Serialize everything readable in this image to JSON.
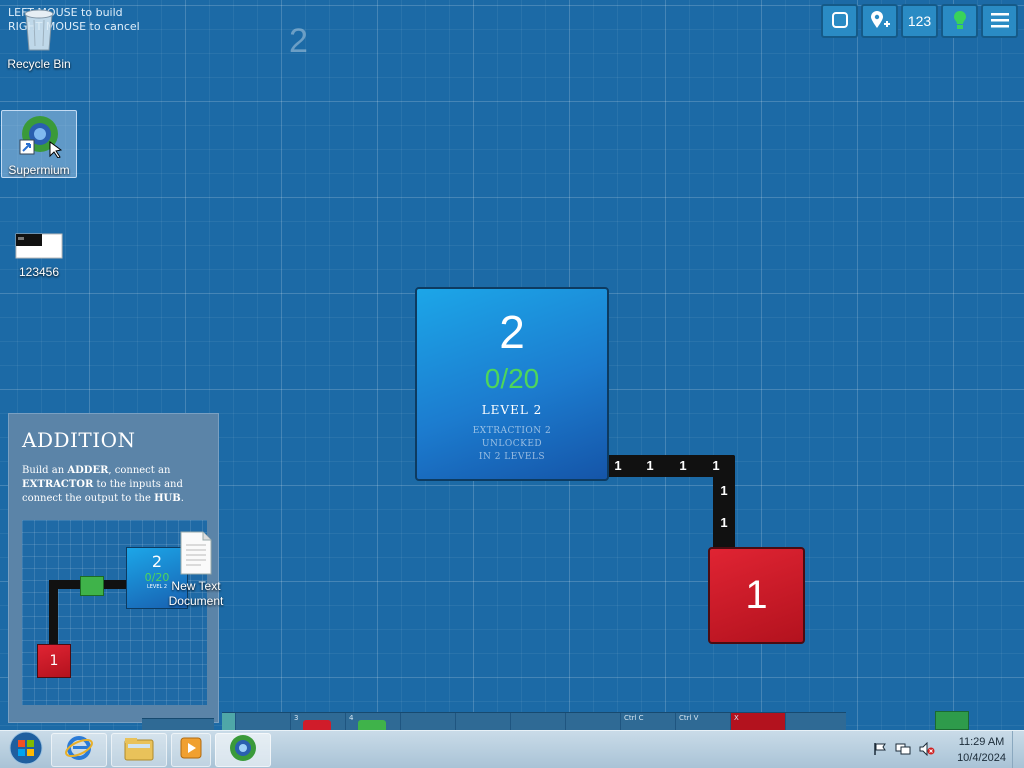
{
  "hint": {
    "line1": "LEFT MOUSE to build",
    "line2": "RIGHT MOUSE to cancel"
  },
  "level_watermark": "2",
  "desktop": {
    "icons": [
      {
        "label": "Recycle Bin"
      },
      {
        "label": "Supermium"
      },
      {
        "label": "123456"
      }
    ],
    "file_icon": {
      "line1": "New Text",
      "line2": "Document"
    }
  },
  "toolbar": {
    "counter_label": "123"
  },
  "hub": {
    "number": "2",
    "progress": "0/20",
    "level": "LEVEL 2",
    "unlock_line1": "EXTRACTION 2",
    "unlock_line2": "UNLOCKED",
    "unlock_line3": "IN 2 LEVELS"
  },
  "extractor": {
    "number": "1"
  },
  "belt_tokens": [
    "1",
    "1",
    "1",
    "1",
    "1",
    "1"
  ],
  "tutorial": {
    "title": "ADDITION",
    "desc_1": "Build an ",
    "desc_adder": "ADDER",
    "desc_2": ", connect an ",
    "desc_extractor": "EXTRACTOR",
    "desc_3": " to the inputs and connect the output to the ",
    "desc_hub": "HUB",
    "desc_4": ".",
    "preview": {
      "hub_number": "2",
      "hub_progress": "0/20",
      "hub_level": "LEVEL 2",
      "extractor_number": "1"
    }
  },
  "toolstrip": {
    "cells": [
      "",
      "",
      "3",
      "4",
      "",
      "",
      "",
      "",
      "Ctrl C",
      "Ctrl V",
      "X"
    ]
  },
  "taskbar": {
    "time": "11:29 AM",
    "date": "10/4/2024"
  },
  "colors": {
    "hub": "#1c7ccf",
    "extractor": "#d01c2a",
    "progress": "#4ed65a",
    "background": "#1c6aa6"
  }
}
